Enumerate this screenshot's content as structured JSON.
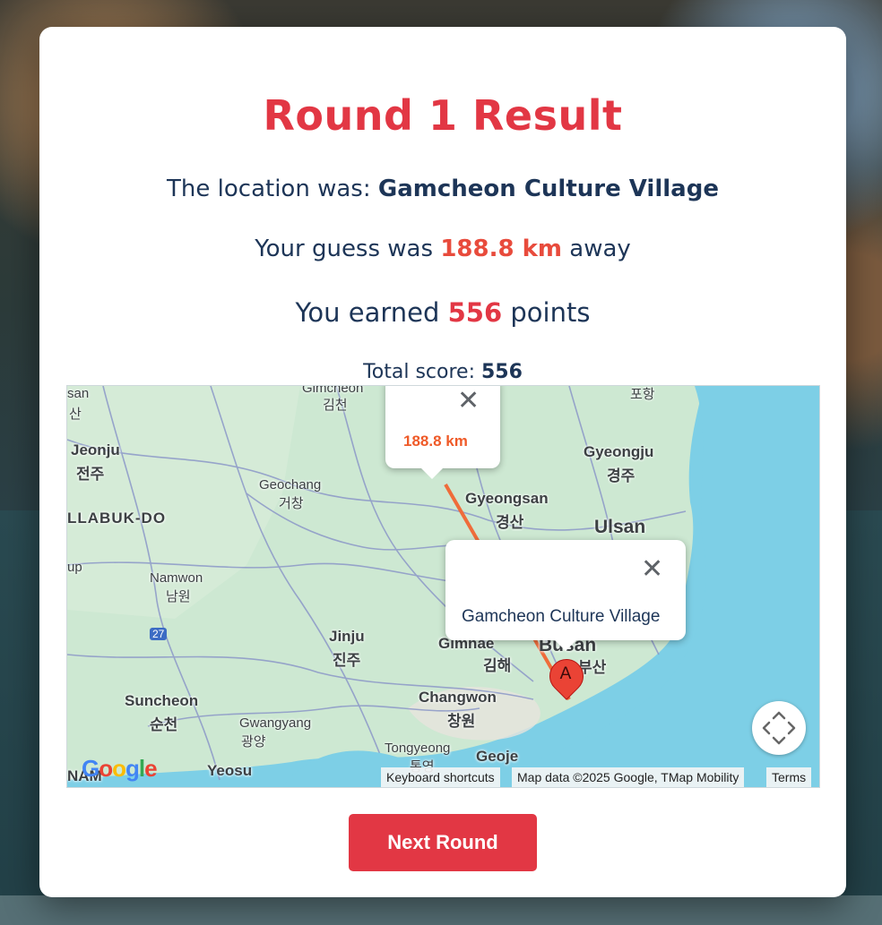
{
  "modal": {
    "title": "Round 1 Result",
    "location_prefix": "The location was:",
    "location_name": "Gamcheon Culture Village",
    "guess_prefix": "Your guess was",
    "distance": "188.8 km",
    "guess_suffix": "away",
    "earned_prefix": "You earned",
    "points": "556",
    "earned_suffix": "points",
    "total_label": "Total score:",
    "total_score": "556",
    "next_button": "Next Round"
  },
  "map": {
    "labels": {
      "san": "san",
      "san_kr": "산",
      "gimcheon": "Gimcheon",
      "gimcheon_kr": "김천",
      "pohang": "포항",
      "jeonju": "Jeonju",
      "jeonju_kr": "전주",
      "gyeongju": "Gyeongju",
      "gyeongju_kr": "경주",
      "geochang": "Geochang",
      "geochang_kr": "거창",
      "gyeongsan": "Gyeongsan",
      "gyeongsan_kr": "경산",
      "jeollabuk": "LLABUK-DO",
      "ulsan": "Ulsan",
      "up": "up",
      "namwon": "Namwon",
      "namwon_kr": "남원",
      "route": "27",
      "jinju": "Jinju",
      "jinju_kr": "진주",
      "gimhae": "Gimhae",
      "gimhae_kr": "김해",
      "busan": "Busan",
      "busan_kr": "부산",
      "suncheon": "Suncheon",
      "suncheon_kr": "순천",
      "gwangyang": "Gwangyang",
      "gwangyang_kr": "광양",
      "changwon": "Changwon",
      "changwon_kr": "창원",
      "tongyeong": "Tongyeong",
      "tongyeong_kr": "통영",
      "geoje": "Geoje",
      "yeosu": "Yeosu",
      "nam": "NAM"
    },
    "distance_popup": "188.8 km",
    "location_popup": "Gamcheon Culture Village",
    "marker_letter": "A",
    "google_logo": "Google",
    "attribution": {
      "shortcuts": "Keyboard shortcuts",
      "data": "Map data ©2025 Google, TMap Mobility",
      "terms": "Terms"
    },
    "colors": {
      "land": "#cde8d2",
      "sea": "#7dcfe6",
      "route": "#ef6c3a",
      "roads": "#8c98c8"
    }
  }
}
